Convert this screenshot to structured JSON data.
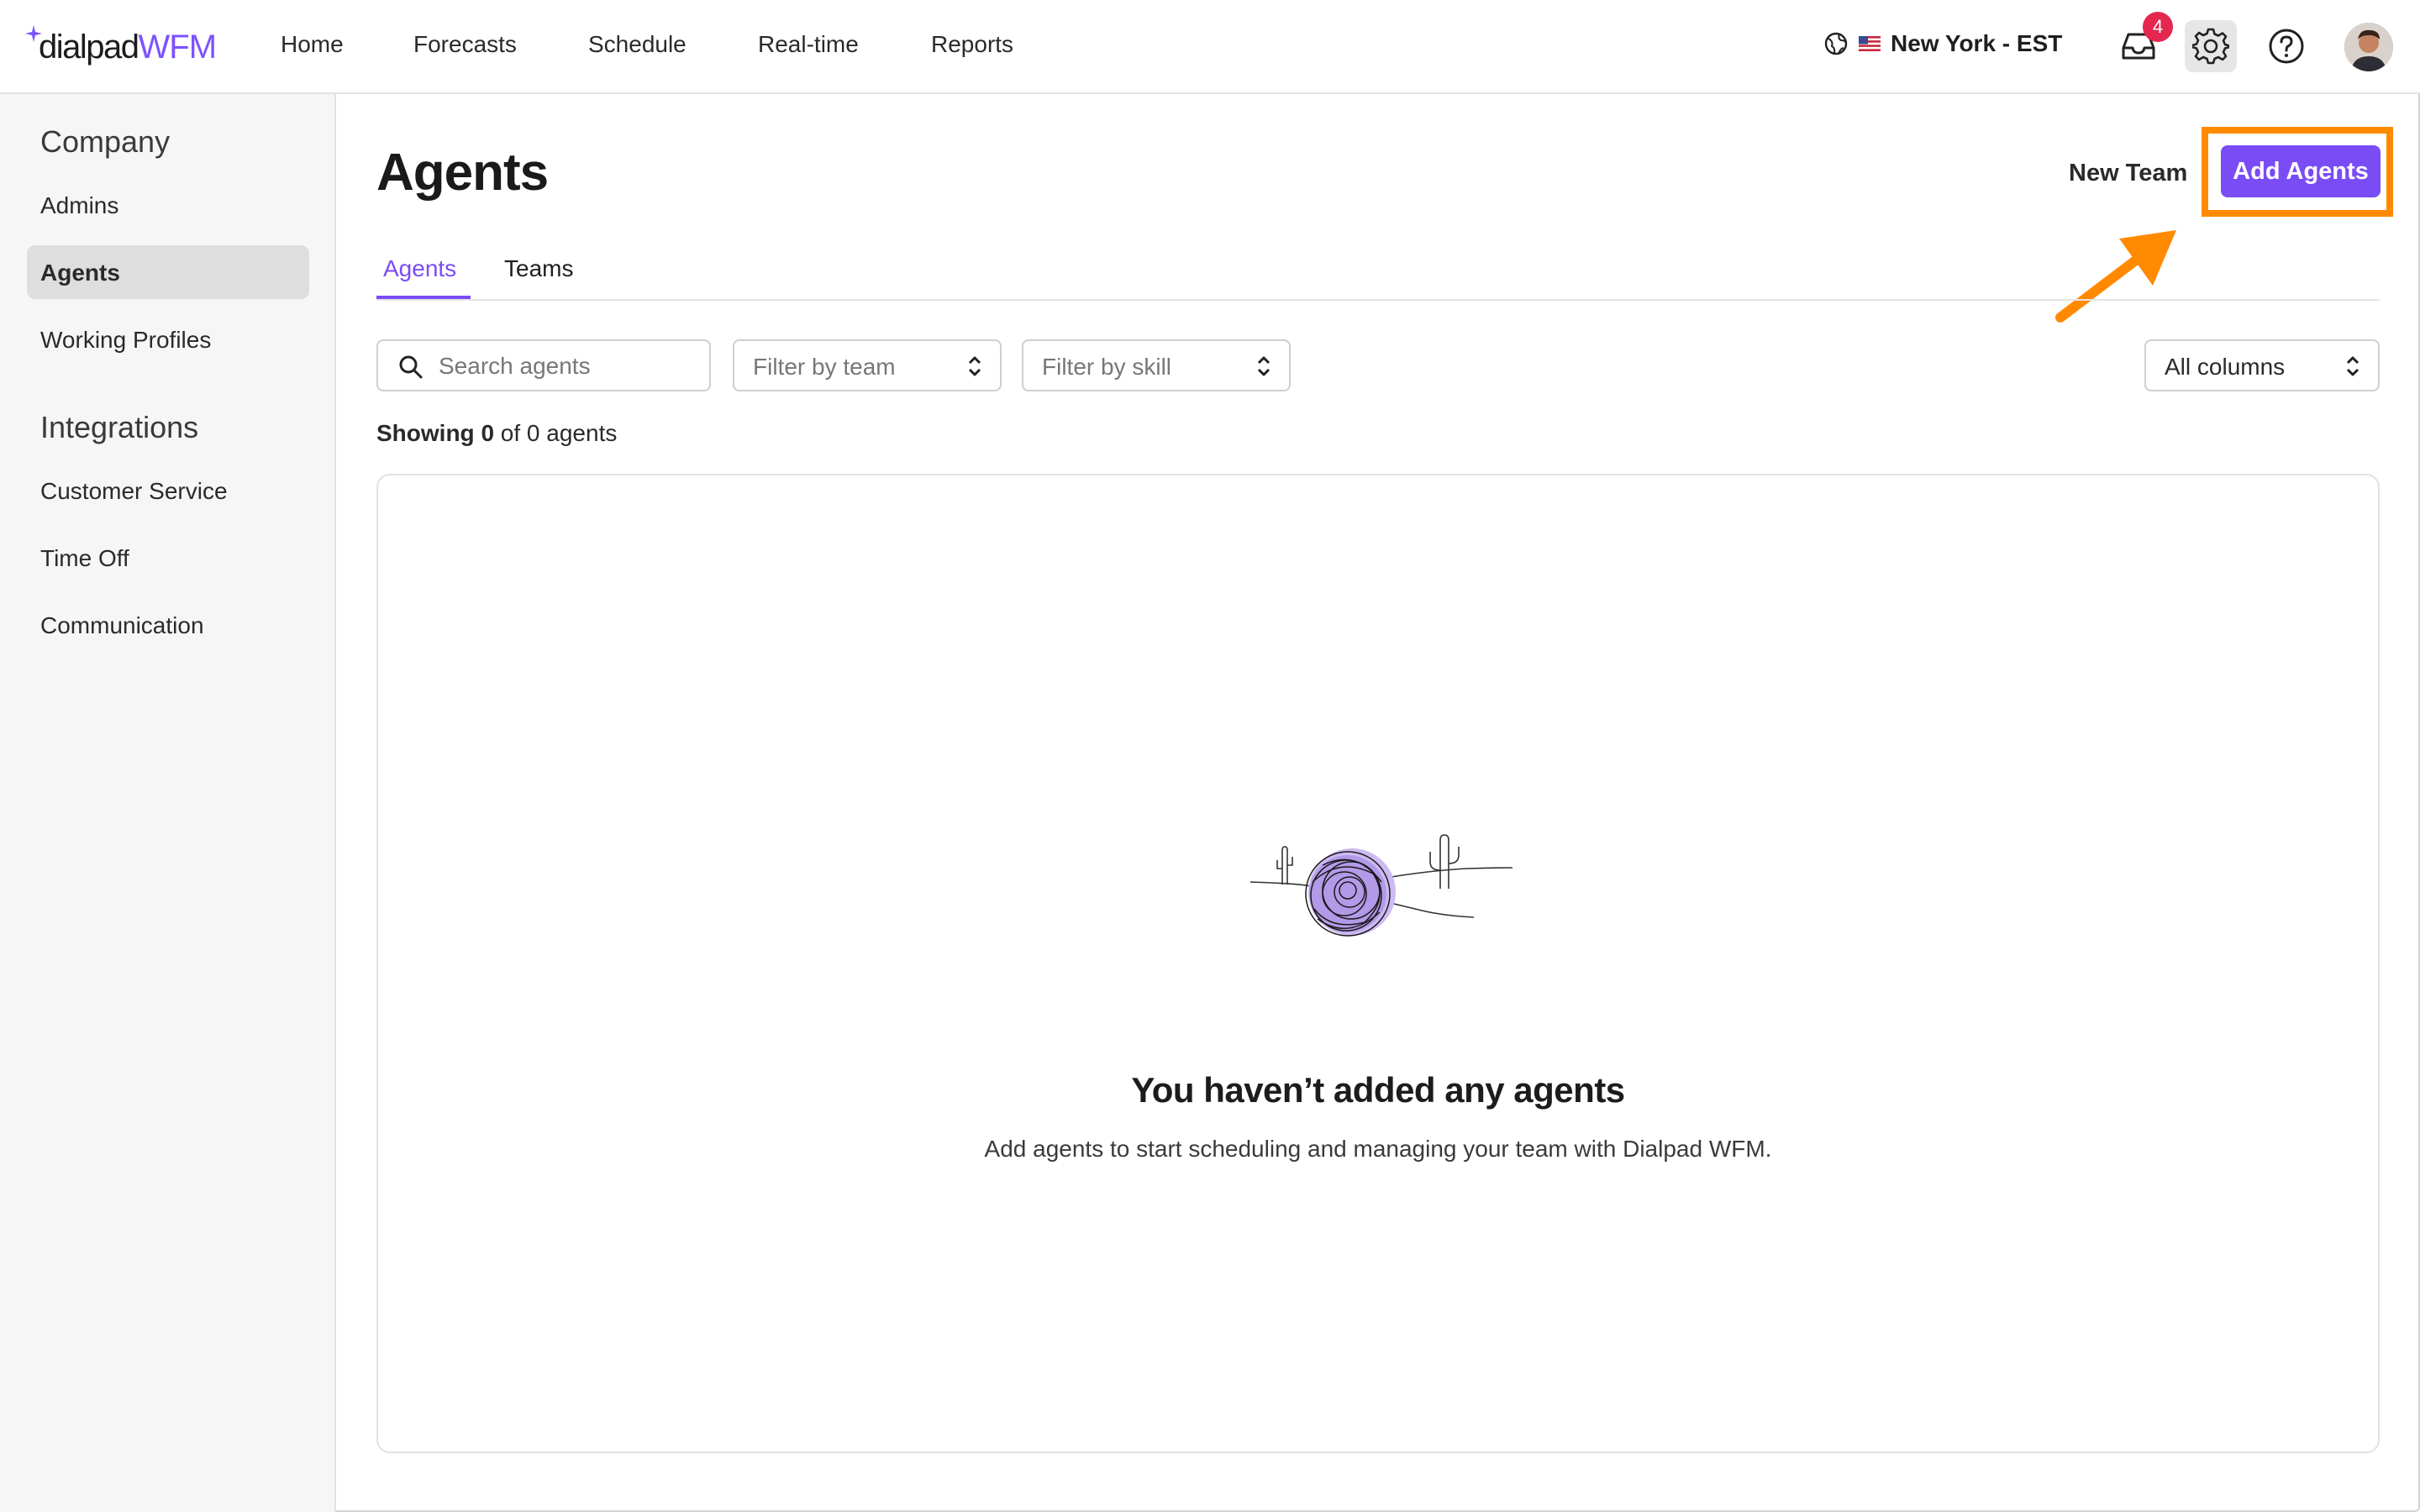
{
  "app": {
    "logo_main": "dialpad",
    "logo_suffix": "WFM",
    "brand_color": "#7a4cf5"
  },
  "nav": {
    "home": "Home",
    "forecasts": "Forecasts",
    "schedule": "Schedule",
    "realtime": "Real-time",
    "reports": "Reports"
  },
  "header": {
    "timezone": "New York - EST",
    "inbox_badge": "4",
    "icons": [
      "globe-icon",
      "us-flag-icon",
      "inbox-icon",
      "gear-icon",
      "help-icon",
      "avatar"
    ]
  },
  "sidebar": {
    "sections": [
      {
        "title": "Company",
        "items": [
          "Admins",
          "Agents",
          "Working Profiles"
        ]
      },
      {
        "title": "Integrations",
        "items": [
          "Customer Service",
          "Time Off",
          "Communication"
        ]
      }
    ],
    "active_item": "Agents"
  },
  "main": {
    "title": "Agents",
    "new_team_label": "New Team",
    "add_agents_label": "Add Agents",
    "tabs": [
      {
        "label": "Agents",
        "active": true
      },
      {
        "label": "Teams",
        "active": false
      }
    ],
    "search_placeholder": "Search agents",
    "filter_team": "Filter by team",
    "filter_skill": "Filter by skill",
    "columns_select": "All columns",
    "showing": {
      "prefix": "Showing",
      "count": "0",
      "middle": "of 0 agents"
    },
    "empty_title": "You haven’t added any agents",
    "empty_subtitle": "Add agents to start scheduling and managing your team with Dialpad WFM."
  },
  "annotation": {
    "highlight_color": "#ff8a00"
  }
}
